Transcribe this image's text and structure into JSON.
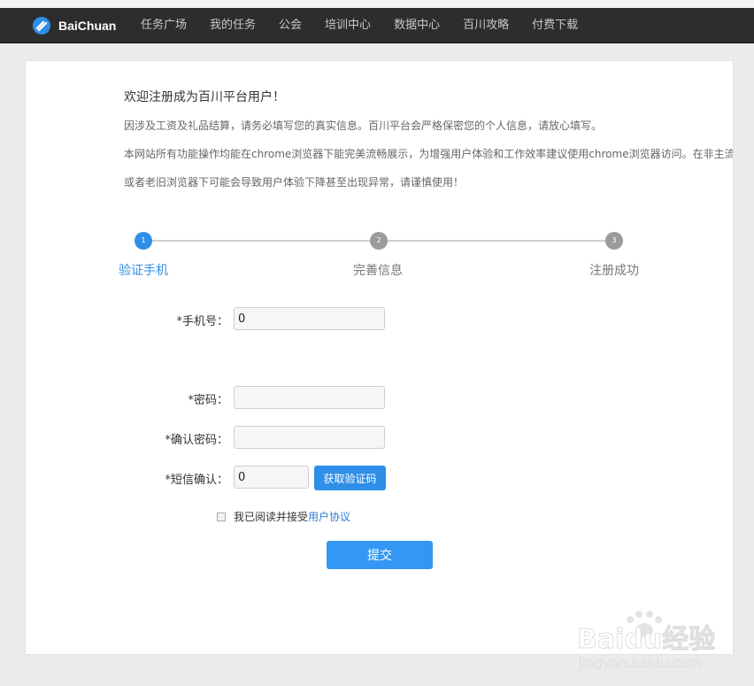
{
  "header": {
    "logo_text": "BaiChuan",
    "nav": [
      "任务广场",
      "我的任务",
      "公会",
      "培训中心",
      "数据中心",
      "百川攻略",
      "付费下载"
    ]
  },
  "intro": {
    "title": "欢迎注册成为百川平台用户！",
    "lines": [
      "因涉及工资及礼品结算，请务必填写您的真实信息。百川平台会严格保密您的个人信息，请放心填写。",
      "本网站所有功能操作均能在chrome浏览器下能完美流畅展示，为增强用户体验和工作效率建议使用chrome浏览器访问。在非主流",
      "或者老旧浏览器下可能会导致用户体验下降甚至出现异常，请谨慎使用！"
    ]
  },
  "steps": [
    {
      "num": "1",
      "label": "验证手机",
      "state": "active"
    },
    {
      "num": "2",
      "label": "完善信息",
      "state": "inactive"
    },
    {
      "num": "3",
      "label": "注册成功",
      "state": "inactive"
    }
  ],
  "form": {
    "phone_label": "*手机号：",
    "phone_value": "0",
    "password_label": "*密码：",
    "password_value": "",
    "confirm_label": "*确认密码：",
    "confirm_value": "",
    "sms_label": "*短信确认：",
    "sms_value": "0",
    "sms_button": "获取验证码",
    "agree_text": "我已阅读并接受",
    "agree_link": "用户协议",
    "agree_checked": false,
    "submit": "提交"
  },
  "watermark": {
    "brand": "Baidu经验",
    "url": "jingyan.baidu.com"
  },
  "colors": {
    "accent": "#2f8fe8",
    "navbar": "#2d2d2d",
    "step_inactive": "#9b9b9b"
  }
}
